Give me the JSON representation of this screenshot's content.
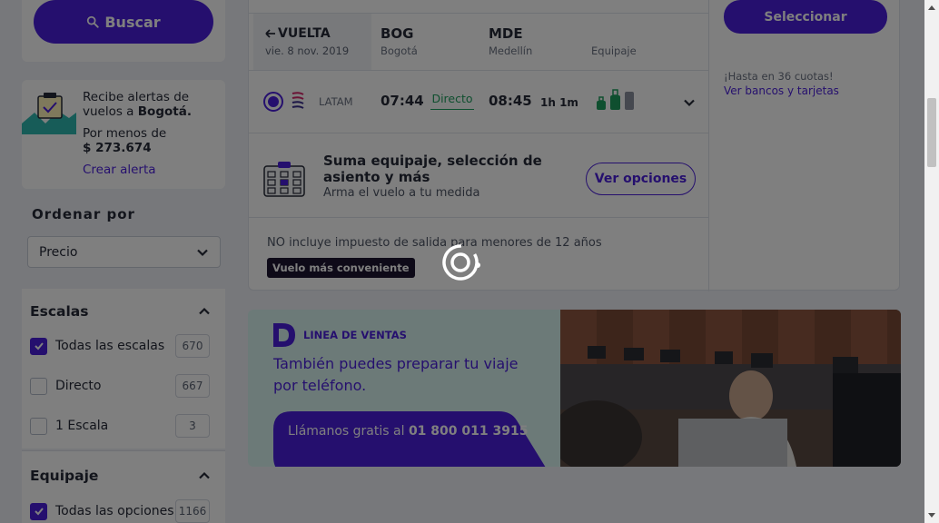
{
  "sidebar": {
    "search_label": "Buscar",
    "alert": {
      "text_prefix": "Recibe alertas de vuelos a ",
      "city": "Bogotá.",
      "price_label": "Por menos de",
      "price": "$ 273.674",
      "link": "Crear alerta"
    },
    "order": {
      "title": "Ordenar por",
      "selected": "Precio"
    },
    "stops": {
      "title": "Escalas",
      "options": [
        {
          "label": "Todas las escalas",
          "count": "670",
          "checked": true
        },
        {
          "label": "Directo",
          "count": "667",
          "checked": false
        },
        {
          "label": "1 Escala",
          "count": "3",
          "checked": false
        }
      ]
    },
    "luggage": {
      "title": "Equipaje",
      "options": [
        {
          "label": "Todas las opciones",
          "count": "1166",
          "checked": true
        }
      ]
    }
  },
  "flight": {
    "direction": "VUELTA",
    "date": "vie. 8 nov. 2019",
    "origin": {
      "code": "BOG",
      "name": "Bogotá"
    },
    "destination": {
      "code": "MDE",
      "name": "Medellín"
    },
    "luggage_label": "Equipaje",
    "airline": "LATAM",
    "departure": "07:44",
    "stops": "Directo",
    "arrival": "08:45",
    "duration": "1h 1m",
    "extras_title": "Suma equipaje, selección de asiento y más",
    "extras_sub": "Arma el vuelo a tu medida",
    "extras_button": "Ver opciones",
    "tax_note": "NO incluye impuesto de salida para menores de 12 años",
    "badge": "Vuelo más conveniente",
    "select_button": "Seleccionar",
    "installments": "¡Hasta en 36 cuotas!",
    "banks_link": "Ver bancos y tarjetas"
  },
  "banner": {
    "kicker": "LINEA DE VENTAS",
    "text": "También puedes preparar tu viaje por teléfono.",
    "call_prefix": "Llámanos gratis al ",
    "phone": "01 800 011 3915"
  },
  "colors": {
    "brand": "#4b1fdc",
    "success": "#1f9e5e",
    "overlay": "rgba(0,0,0,0.5)"
  }
}
